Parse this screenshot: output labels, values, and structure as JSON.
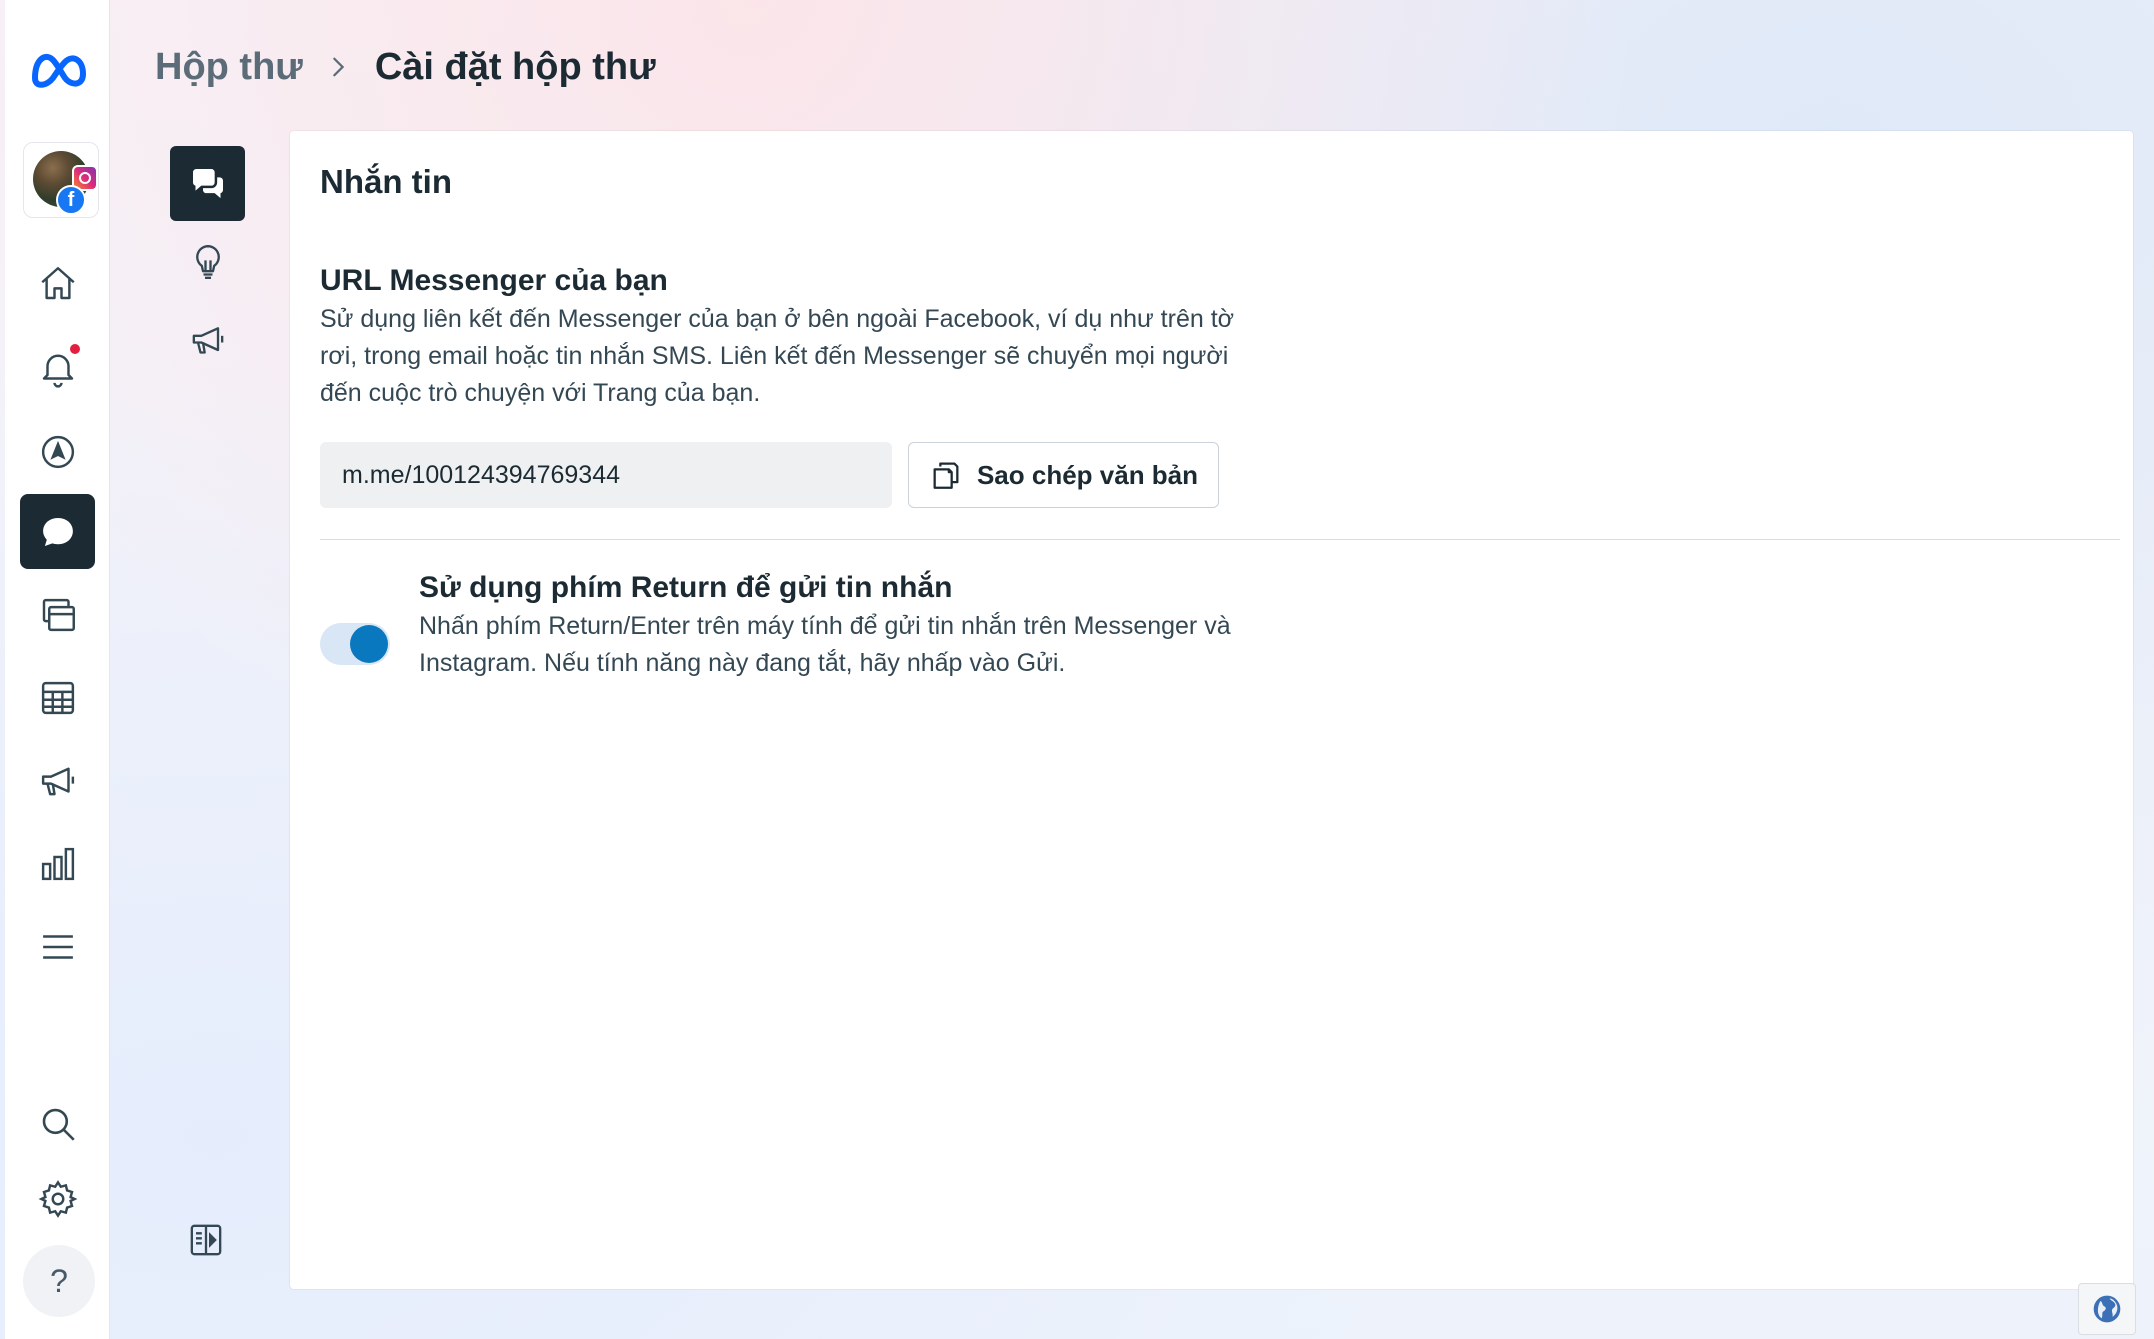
{
  "breadcrumb": {
    "parent": "Hộp thư",
    "current": "Cài đặt hộp thư"
  },
  "rail": {
    "items": [
      {
        "icon": "home-icon"
      },
      {
        "icon": "bell-icon",
        "has_notification": true
      },
      {
        "icon": "compass-icon"
      },
      {
        "icon": "chat-bubble-icon",
        "active": true
      },
      {
        "icon": "pages-icon"
      },
      {
        "icon": "table-icon"
      },
      {
        "icon": "megaphone-icon"
      },
      {
        "icon": "bar-chart-icon"
      },
      {
        "icon": "menu-icon"
      }
    ],
    "bottom": [
      {
        "icon": "search-icon"
      },
      {
        "icon": "gear-icon"
      },
      {
        "icon": "help-icon",
        "label": "?"
      }
    ]
  },
  "subnav": [
    {
      "icon": "chat-bubbles-icon",
      "active": true
    },
    {
      "icon": "lightbulb-icon"
    },
    {
      "icon": "megaphone-icon"
    }
  ],
  "card": {
    "title": "Nhắn tin",
    "url_section": {
      "title": "URL Messenger của bạn",
      "description": "Sử dụng liên kết đến Messenger của bạn ở bên ngoài Facebook, ví dụ như trên tờ rơi, trong email hoặc tin nhắn SMS. Liên kết đến Messenger sẽ chuyển mọi người đến cuộc trò chuyện với Trang của bạn.",
      "url_value": "m.me/100124394769344",
      "copy_button_label": "Sao chép văn bản"
    },
    "return_section": {
      "title": "Sử dụng phím Return để gửi tin nhắn",
      "description": "Nhấn phím Return/Enter trên máy tính để gửi tin nhắn trên Messenger và Instagram. Nếu tính năng này đang tắt, hãy nhấp vào Gửi.",
      "enabled": true
    }
  },
  "colors": {
    "accent": "#0a78be",
    "active_nav": "#1c2b33",
    "notification": "#e41e3f",
    "text_primary": "#1c2b33"
  }
}
